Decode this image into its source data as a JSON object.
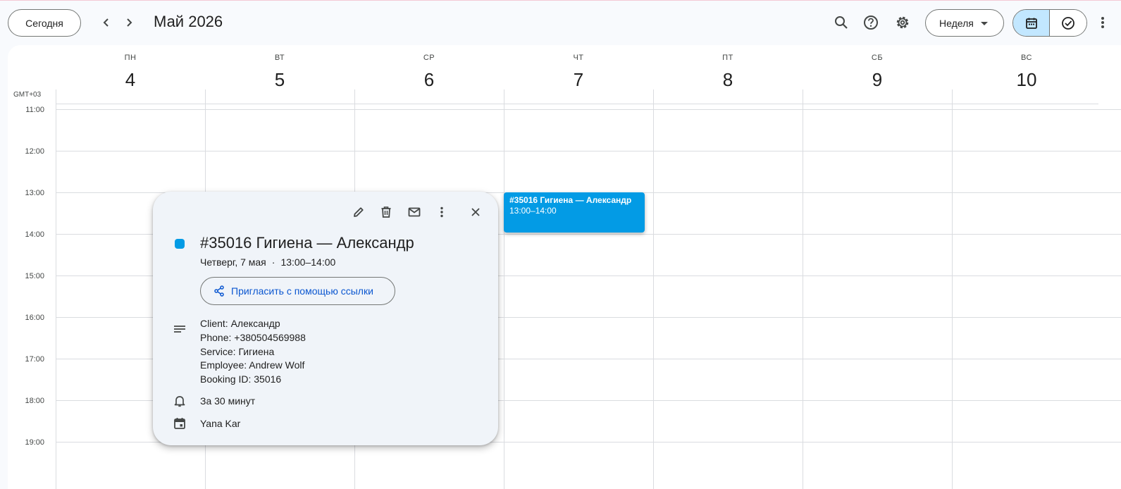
{
  "header": {
    "today_label": "Сегодня",
    "title": "Май 2026",
    "view_label": "Неделя"
  },
  "calendar": {
    "timezone": "GMT+03",
    "days": [
      {
        "name": "ПН",
        "num": "4"
      },
      {
        "name": "ВТ",
        "num": "5"
      },
      {
        "name": "СР",
        "num": "6"
      },
      {
        "name": "ЧТ",
        "num": "7"
      },
      {
        "name": "ПТ",
        "num": "8"
      },
      {
        "name": "СБ",
        "num": "9"
      },
      {
        "name": "ВС",
        "num": "10"
      }
    ],
    "hours": [
      "11:00",
      "12:00",
      "13:00",
      "14:00",
      "15:00",
      "16:00",
      "17:00",
      "18:00",
      "19:00"
    ]
  },
  "event": {
    "title": "#35016 Гигиена — Александр",
    "time": "13:00–14:00",
    "color": "#039be5"
  },
  "popup": {
    "title": "#35016 Гигиена — Александр",
    "date": "Четверг, 7 мая",
    "time": "13:00–14:00",
    "invite_label": "Пригласить с помощью ссылки",
    "description": [
      "Client: Александр",
      "Phone: +380504569988",
      "Service: Гигиена",
      "Employee: Andrew Wolf",
      "Booking ID: 35016"
    ],
    "reminder": "За 30 минут",
    "calendar_owner": "Yana Kar"
  }
}
